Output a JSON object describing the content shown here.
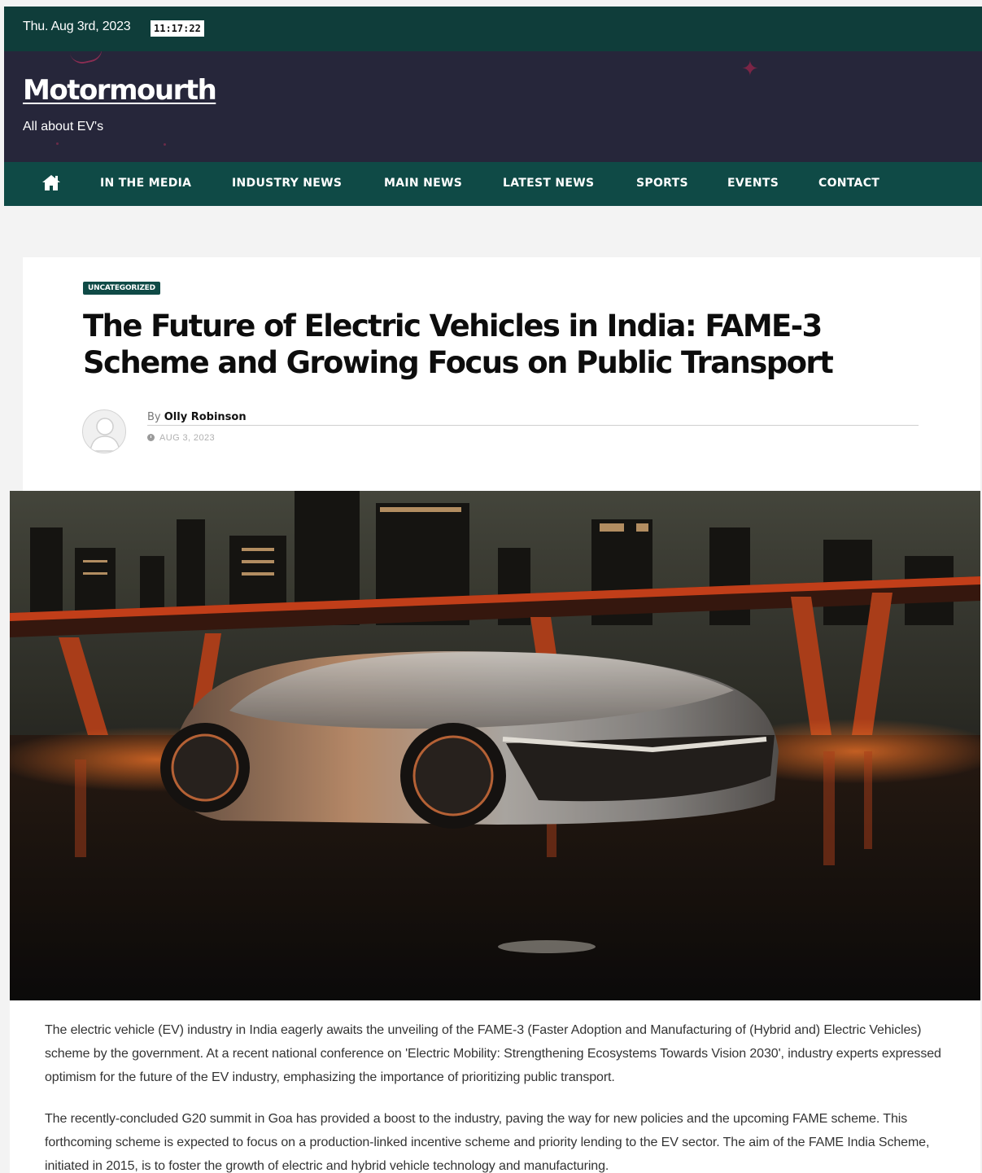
{
  "topbar": {
    "date": "Thu. Aug 3rd, 2023",
    "time": "11:17:22"
  },
  "site": {
    "title": "Motormourth",
    "tagline": "All about EV's"
  },
  "nav": {
    "home_icon": "home-icon",
    "items": [
      "IN THE MEDIA",
      "INDUSTRY NEWS",
      "MAIN NEWS",
      "LATEST NEWS",
      "SPORTS",
      "EVENTS",
      "CONTACT"
    ]
  },
  "article": {
    "category": "UNCATEGORIZED",
    "title": "The Future of Electric Vehicles in India: FAME-3 Scheme and Growing Focus on Public Transport",
    "by_prefix": "By",
    "author": "Olly Robinson",
    "date": "AUG 3, 2023",
    "paragraphs": [
      "The electric vehicle (EV) industry in India eagerly awaits the unveiling of the FAME-3 (Faster Adoption and Manufacturing of (Hybrid and) Electric Vehicles) scheme by the government. At a recent national conference on 'Electric Mobility: Strengthening Ecosystems Towards Vision 2030', industry experts expressed optimism for the future of the EV industry, emphasizing the importance of prioritizing public transport.",
      "The recently-concluded G20 summit in Goa has provided a boost to the industry, paving the way for new policies and the upcoming FAME scheme. This forthcoming scheme is expected to focus on a production-linked incentive scheme and priority lending to the EV sector. The aim of the FAME India Scheme, initiated in 2015, is to foster the growth of electric and hybrid vehicle technology and manufacturing."
    ]
  },
  "colors": {
    "topbar": "#0f3d3a",
    "brand_bg": "#26263a",
    "nav_bg": "#0f4a46",
    "accent": "#0f4a46"
  }
}
